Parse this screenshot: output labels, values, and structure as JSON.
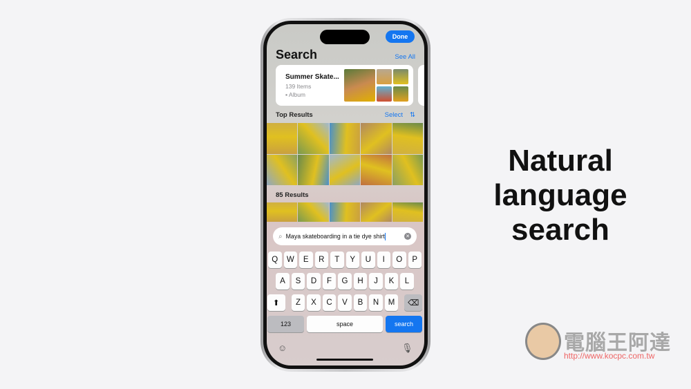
{
  "status": {
    "done_label": "Done"
  },
  "header": {
    "title": "Search",
    "see_all": "See All"
  },
  "album": {
    "name": "Summer Skate...",
    "count": "139 Items",
    "type": "Album",
    "icon": "album-icon"
  },
  "top_results": {
    "label": "Top Results",
    "select": "Select",
    "sort_icon": "sort-arrows-icon"
  },
  "results": {
    "label": "85 Results"
  },
  "search": {
    "value": "Maya skateboarding in a tie dye shirt",
    "icon": "magnifier-icon",
    "clear_icon": "clear-x-icon"
  },
  "keyboard": {
    "row1": [
      "Q",
      "W",
      "E",
      "R",
      "T",
      "Y",
      "U",
      "I",
      "O",
      "P"
    ],
    "row2": [
      "A",
      "S",
      "D",
      "F",
      "G",
      "H",
      "J",
      "K",
      "L"
    ],
    "row3": [
      "Z",
      "X",
      "C",
      "V",
      "B",
      "N",
      "M"
    ],
    "numbers": "123",
    "space": "space",
    "search": "search",
    "accent": "#1476f0"
  },
  "headline": "Natural language search",
  "watermark": {
    "name": "電腦王阿達",
    "url": "http://www.kocpc.com.tw"
  }
}
